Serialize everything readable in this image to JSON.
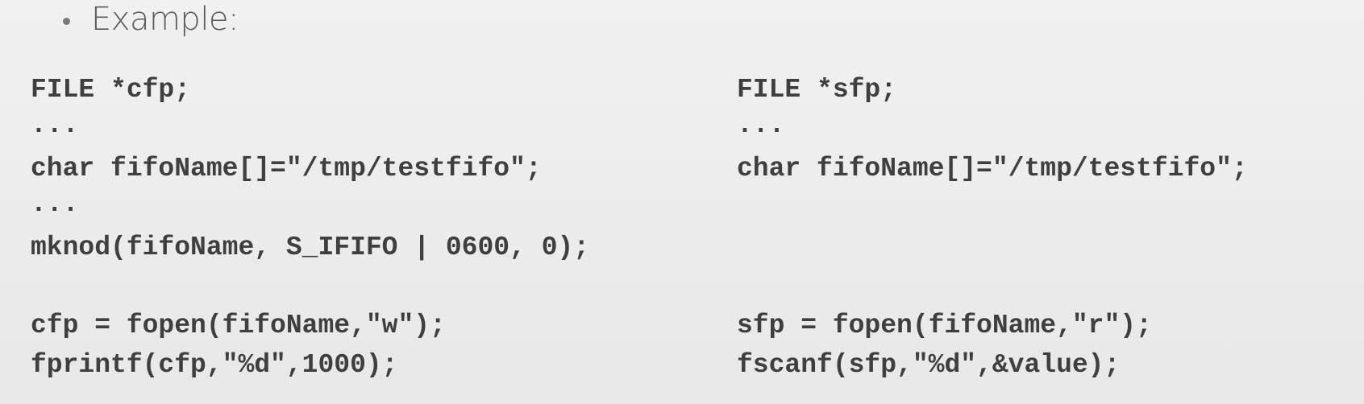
{
  "bullet": {
    "text": "Example:"
  },
  "left_code": [
    "FILE *cfp;",
    "...",
    "char fifoName[]=\"/tmp/testfifo\";",
    "...",
    "mknod(fifoName, S_IFIFO | 0600, 0);",
    "cfp = fopen(fifoName,\"w\");",
    "fprintf(cfp,\"%d\",1000);"
  ],
  "right_code": [
    "FILE *sfp;",
    "...",
    "char fifoName[]=\"/tmp/testfifo\";",
    "sfp = fopen(fifoName,\"r\");",
    "fscanf(sfp,\"%d\",&value);"
  ]
}
